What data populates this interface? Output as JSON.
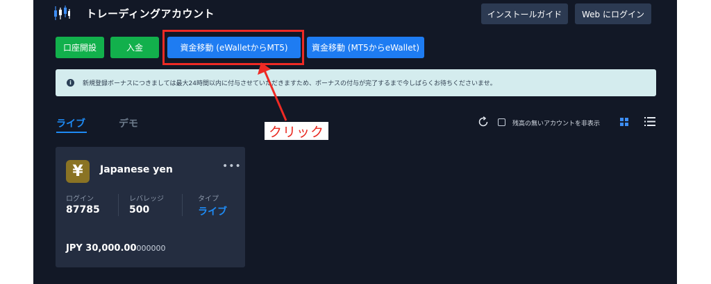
{
  "header": {
    "title": "トレーディングアカウント",
    "install_guide": "インストールガイド",
    "web_login": "Web にログイン"
  },
  "actions": {
    "open_account": "口座開設",
    "deposit": "入金",
    "transfer_ewallet_to_mt5": "資金移動 (eWalletからMT5)",
    "transfer_mt5_to_ewallet": "資金移動 (MT5からeWallet)"
  },
  "notice": {
    "icon": "info-icon",
    "text": "新規登録ボーナスにつきましては最大24時間以内に付与させていただきますため、ボーナスの付与が完了するまで今しばらくお待ちくださいませ。"
  },
  "tabs": {
    "live": "ライブ",
    "demo": "デモ"
  },
  "tools": {
    "hide_zero_balance": "残高の無いアカウントを非表示"
  },
  "card": {
    "currency_symbol": "¥",
    "name": "Japanese yen",
    "login_label": "ログイン",
    "login_value": "87785",
    "leverage_label": "レバレッジ",
    "leverage_value": "500",
    "type_label": "タイプ",
    "type_value": "ライブ",
    "balance_main": "JPY 30,000.00",
    "balance_frac": "000000"
  },
  "annotation": {
    "click_label": "クリック",
    "color": "#ee2a24"
  },
  "colors": {
    "background": "#121826",
    "green": "#12b04c",
    "blue": "#1e7cf2",
    "accent": "#1e8bf5"
  }
}
